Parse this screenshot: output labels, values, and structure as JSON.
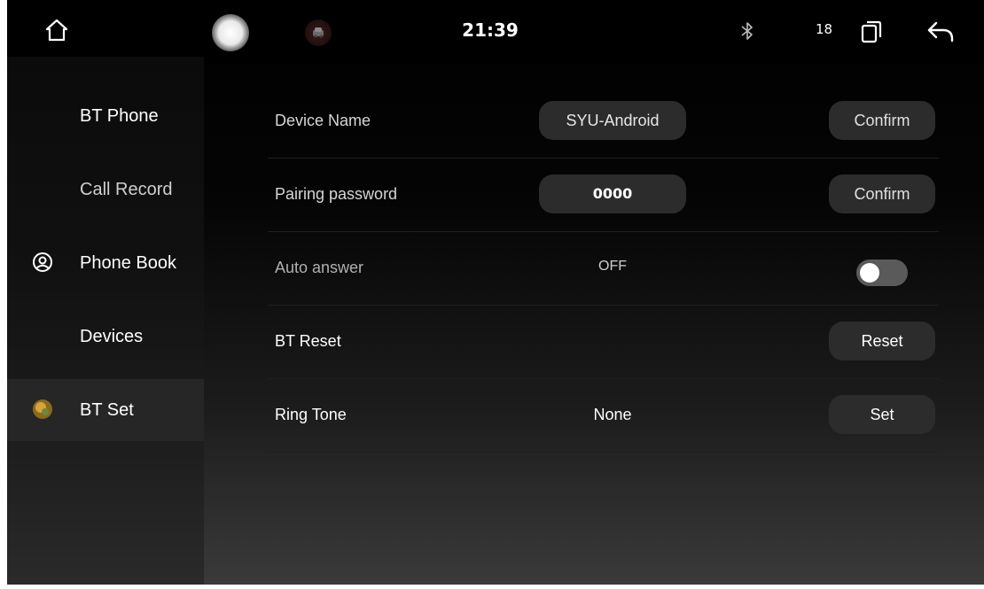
{
  "status_bar": {
    "time": "21:39",
    "volume": "18",
    "icons": [
      "home-icon",
      "floating-ball-icon",
      "car-icon",
      "bluetooth-icon",
      "recents-icon",
      "back-icon"
    ]
  },
  "sidebar": {
    "items": [
      {
        "label": "BT Phone",
        "icon": ""
      },
      {
        "label": "Call Record",
        "icon": ""
      },
      {
        "label": "Phone Book",
        "icon": "contact-circle-icon"
      },
      {
        "label": "Devices",
        "icon": ""
      },
      {
        "label": "BT Set",
        "icon": "settings-badge-icon",
        "active": true
      }
    ]
  },
  "settings": {
    "device_name": {
      "label": "Device Name",
      "value": "SYU-Android",
      "action": "Confirm"
    },
    "pairing_password": {
      "label": "Pairing password",
      "value": "0000",
      "action": "Confirm"
    },
    "auto_answer": {
      "label": "Auto answer",
      "value": "OFF",
      "enabled": false
    },
    "bt_reset": {
      "label": "BT Reset",
      "action": "Reset"
    },
    "ring_tone": {
      "label": "Ring Tone",
      "value": "None",
      "action": "Set"
    }
  },
  "colors": {
    "background_top": "#000000",
    "background_bottom": "#3a3a3a",
    "pill": "#2c2c2c",
    "text": "#ffffff"
  }
}
